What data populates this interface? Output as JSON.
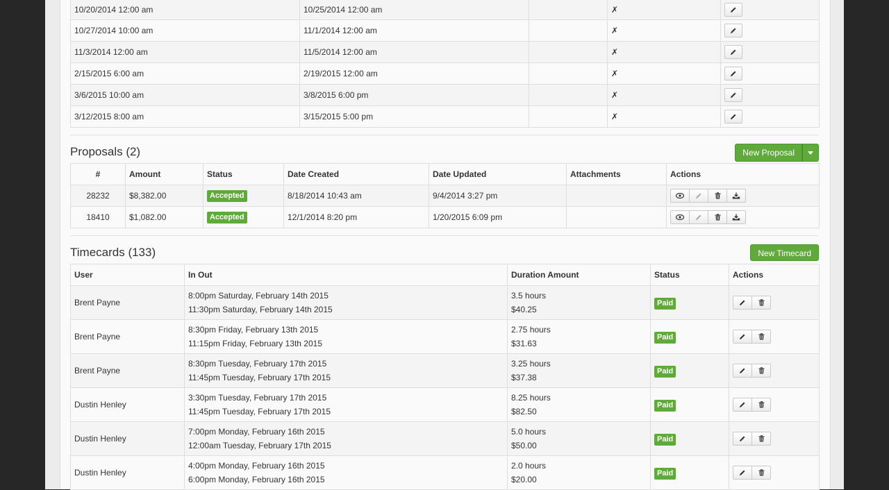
{
  "icons": {
    "x_mark": "✗"
  },
  "top_table": {
    "rows": [
      {
        "start": "10/20/2014 12:00 am",
        "end": "10/25/2014 12:00 am"
      },
      {
        "start": "10/27/2014 10:00 am",
        "end": "11/1/2014 12:00 am"
      },
      {
        "start": "11/3/2014 12:00 am",
        "end": "11/5/2014 12:00 am"
      },
      {
        "start": "2/15/2015 6:00 am",
        "end": "2/19/2015 12:00 am"
      },
      {
        "start": "3/6/2015 10:00 am",
        "end": "3/8/2015 6:00 pm"
      },
      {
        "start": "3/12/2015 8:00 am",
        "end": "3/15/2015 5:00 pm"
      }
    ]
  },
  "proposals": {
    "title": "Proposals (2)",
    "new_button": "New Proposal",
    "headers": {
      "num": "#",
      "amount": "Amount",
      "status": "Status",
      "created": "Date Created",
      "updated": "Date Updated",
      "attachments": "Attachments",
      "actions": "Actions"
    },
    "rows": [
      {
        "num": "28232",
        "amount": "$8,382.00",
        "status": "Accepted",
        "created": "8/18/2014 10:43 am",
        "updated": "9/4/2014 3:27 pm"
      },
      {
        "num": "18410",
        "amount": "$1,082.00",
        "status": "Accepted",
        "created": "12/1/2014 8:20 pm",
        "updated": "1/20/2015 6:09 pm"
      }
    ]
  },
  "timecards": {
    "title": "Timecards (133)",
    "new_button": "New Timecard",
    "headers": {
      "user": "User",
      "inout": "In Out",
      "duration": "Duration Amount",
      "status": "Status",
      "actions": "Actions"
    },
    "rows": [
      {
        "user": "Brent Payne",
        "in": "8:00pm Saturday, February 14th 2015",
        "out": "11:30pm Saturday, February 14th 2015",
        "hours": "3.5 hours",
        "amount": "$40.25",
        "status": "Paid"
      },
      {
        "user": "Brent Payne",
        "in": "8:30pm Friday, February 13th 2015",
        "out": "11:15pm Friday, February 13th 2015",
        "hours": "2.75 hours",
        "amount": "$31.63",
        "status": "Paid"
      },
      {
        "user": "Brent Payne",
        "in": "8:30pm Tuesday, February 17th 2015",
        "out": "11:45pm Tuesday, February 17th 2015",
        "hours": "3.25 hours",
        "amount": "$37.38",
        "status": "Paid"
      },
      {
        "user": "Dustin Henley",
        "in": "3:30pm Tuesday, February 17th 2015",
        "out": "11:45pm Tuesday, February 17th 2015",
        "hours": "8.25 hours",
        "amount": "$82.50",
        "status": "Paid"
      },
      {
        "user": "Dustin Henley",
        "in": "7:00pm Monday, February 16th 2015",
        "out": "12:00am Tuesday, February 17th 2015",
        "hours": "5.0 hours",
        "amount": "$50.00",
        "status": "Paid"
      },
      {
        "user": "Dustin Henley",
        "in": "4:00pm Monday, February 16th 2015",
        "out": "6:00pm Monday, February 16th 2015",
        "hours": "2.0 hours",
        "amount": "$20.00",
        "status": "Paid"
      }
    ]
  }
}
